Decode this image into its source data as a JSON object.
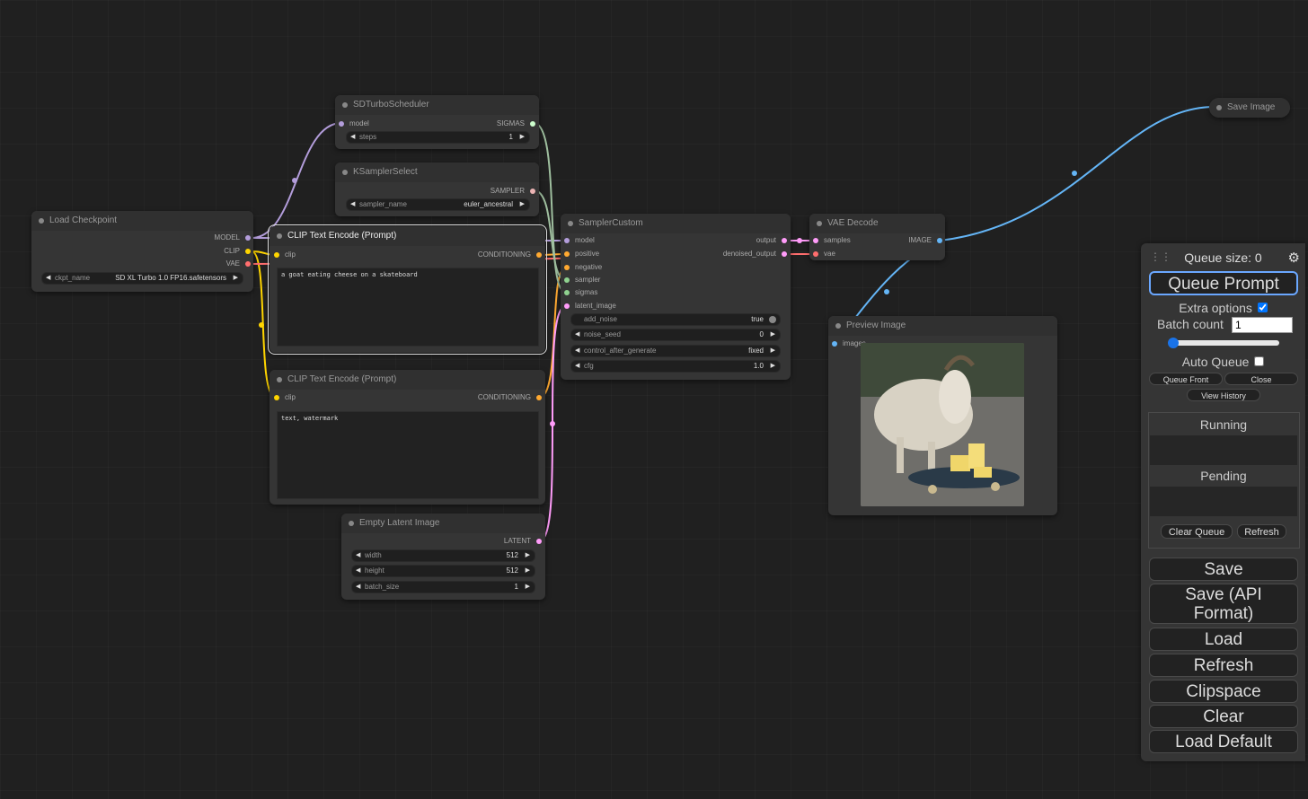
{
  "nodes": {
    "sd_turbo_scheduler": {
      "title": "SDTurboScheduler",
      "in_model": "model",
      "out_sigmas": "SIGMAS",
      "steps_label": "steps",
      "steps_value": "1"
    },
    "ksampler_select": {
      "title": "KSamplerSelect",
      "out_sampler": "SAMPLER",
      "sampler_name_label": "sampler_name",
      "sampler_name_value": "euler_ancestral"
    },
    "load_checkpoint": {
      "title": "Load Checkpoint",
      "out_model": "MODEL",
      "out_clip": "CLIP",
      "out_vae": "VAE",
      "ckpt_name_label": "ckpt_name",
      "ckpt_name_value": "SD XL Turbo 1.0 FP16.safetensors"
    },
    "clip_text_pos": {
      "title": "CLIP Text Encode (Prompt)",
      "in_clip": "clip",
      "out_conditioning": "CONDITIONING",
      "text": "a goat eating cheese on a skateboard"
    },
    "clip_text_neg": {
      "title": "CLIP Text Encode (Prompt)",
      "in_clip": "clip",
      "out_conditioning": "CONDITIONING",
      "text": "text, watermark"
    },
    "empty_latent": {
      "title": "Empty Latent Image",
      "out_latent": "LATENT",
      "width_label": "width",
      "width_value": "512",
      "height_label": "height",
      "height_value": "512",
      "batch_label": "batch_size",
      "batch_value": "1"
    },
    "sampler_custom": {
      "title": "SamplerCustom",
      "in_model": "model",
      "in_positive": "positive",
      "in_negative": "negative",
      "in_sampler": "sampler",
      "in_sigmas": "sigmas",
      "in_latent": "latent_image",
      "out_output": "output",
      "out_denoised": "denoised_output",
      "add_noise_label": "add_noise",
      "add_noise_value": "true",
      "noise_seed_label": "noise_seed",
      "noise_seed_value": "0",
      "control_label": "control_after_generate",
      "control_value": "fixed",
      "cfg_label": "cfg",
      "cfg_value": "1.0"
    },
    "vae_decode": {
      "title": "VAE Decode",
      "in_samples": "samples",
      "in_vae": "vae",
      "out_image": "IMAGE"
    },
    "preview_image": {
      "title": "Preview Image",
      "in_images": "images"
    },
    "save_image": {
      "title": "Save Image"
    }
  },
  "panel": {
    "queue_size": "Queue size: 0",
    "queue_prompt": "Queue Prompt",
    "extra_options": "Extra options",
    "extra_options_checked": true,
    "batch_count_label": "Batch count",
    "batch_count_value": "1",
    "auto_queue": "Auto Queue",
    "queue_front": "Queue Front",
    "close": "Close",
    "view_history": "View History",
    "running": "Running",
    "pending": "Pending",
    "clear_queue": "Clear Queue",
    "refresh_small": "Refresh",
    "buttons": [
      "Save",
      "Save (API Format)",
      "Load",
      "Refresh",
      "Clipspace",
      "Clear",
      "Load Default"
    ]
  },
  "colors": {
    "model": "#b39ddb",
    "clip": "#ffd500",
    "vae": "#ff6e6e",
    "conditioning": "#ffa931",
    "latent": "#ff9cf9",
    "image": "#64b5f6",
    "sigmas": "#cdffcd",
    "sampler": "#ecb4b4"
  }
}
